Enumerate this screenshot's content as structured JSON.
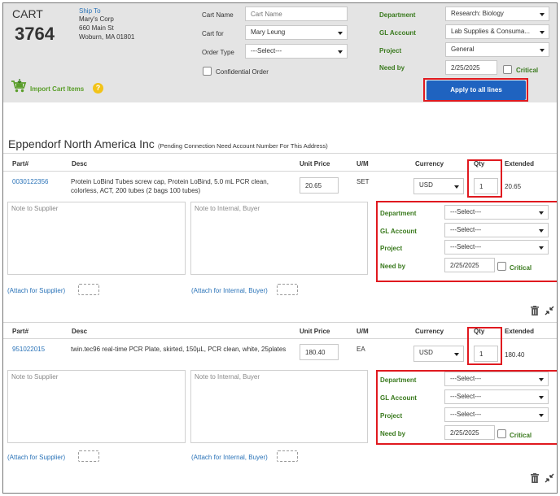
{
  "header": {
    "cart_label": "CART",
    "cart_number": "3764",
    "ship_to": {
      "label": "Ship To",
      "name": "Mary's Corp",
      "street": "660 Main St",
      "city": "Woburn, MA 01801"
    },
    "cart_name": {
      "label": "Cart Name",
      "placeholder": "Cart Name"
    },
    "cart_for": {
      "label": "Cart for",
      "value": "Mary Leung"
    },
    "order_type": {
      "label": "Order Type",
      "value": "---Select---"
    },
    "confidential": {
      "label": "Confidential Order"
    },
    "department": {
      "label": "Department",
      "value": "Research: Biology"
    },
    "gl_account": {
      "label": "GL Account",
      "value": "Lab Supplies & Consuma..."
    },
    "project": {
      "label": "Project",
      "value": "General"
    },
    "need_by": {
      "label": "Need by",
      "value": "2/25/2025"
    },
    "critical_label": "Critical",
    "import_label": "Import Cart Items",
    "help_glyph": "?",
    "apply_button": "Apply to all lines"
  },
  "supplier": {
    "name": "Eppendorf North America Inc",
    "note": "(Pending Connection Need Account Number For This Address)"
  },
  "columns": {
    "part": "Part#",
    "desc": "Desc",
    "unit_price": "Unit Price",
    "um": "U/M",
    "currency": "Currency",
    "qty": "Qty",
    "extended": "Extended"
  },
  "lines": [
    {
      "part": "0030122356",
      "desc": "Protein LoBind Tubes screw cap, Protein LoBind, 5.0 mL PCR clean, colorless, ACT, 200 tubes (2 bags 100 tubes)",
      "unit_price": "20.65",
      "um": "SET",
      "currency": "USD",
      "qty": "1",
      "extended": "20.65",
      "note_supplier": "Note to Supplier",
      "note_internal": "Note to Internal, Buyer",
      "attach_supplier": "(Attach for Supplier)",
      "attach_internal": "(Attach for Internal, Buyer)",
      "department": {
        "label": "Department",
        "value": "---Select---"
      },
      "gl_account": {
        "label": "GL Account",
        "value": "---Select---"
      },
      "project": {
        "label": "Project",
        "value": "---Select---"
      },
      "need_by": {
        "label": "Need by",
        "value": "2/25/2025"
      },
      "critical": "Critical"
    },
    {
      "part": "951022015",
      "desc": "twin.tec96 real-time PCR Plate, skirted, 150µL, PCR clean, white, 25plates",
      "unit_price": "180.40",
      "um": "EA",
      "currency": "USD",
      "qty": "1",
      "extended": "180.40",
      "note_supplier": "Note to Supplier",
      "note_internal": "Note to Internal, Buyer",
      "attach_supplier": "(Attach for Supplier)",
      "attach_internal": "(Attach for Internal, Buyer)",
      "department": {
        "label": "Department",
        "value": "---Select---"
      },
      "gl_account": {
        "label": "GL Account",
        "value": "---Select---"
      },
      "project": {
        "label": "Project",
        "value": "---Select---"
      },
      "need_by": {
        "label": "Need by",
        "value": "2/25/2025"
      },
      "critical": "Critical"
    }
  ],
  "colors": {
    "header_bg": "#e4e4e4",
    "accent_blue": "#1f63c0",
    "link_blue": "#2a73b8",
    "label_green": "#3a7a1e",
    "highlight_red": "#e0191f"
  }
}
